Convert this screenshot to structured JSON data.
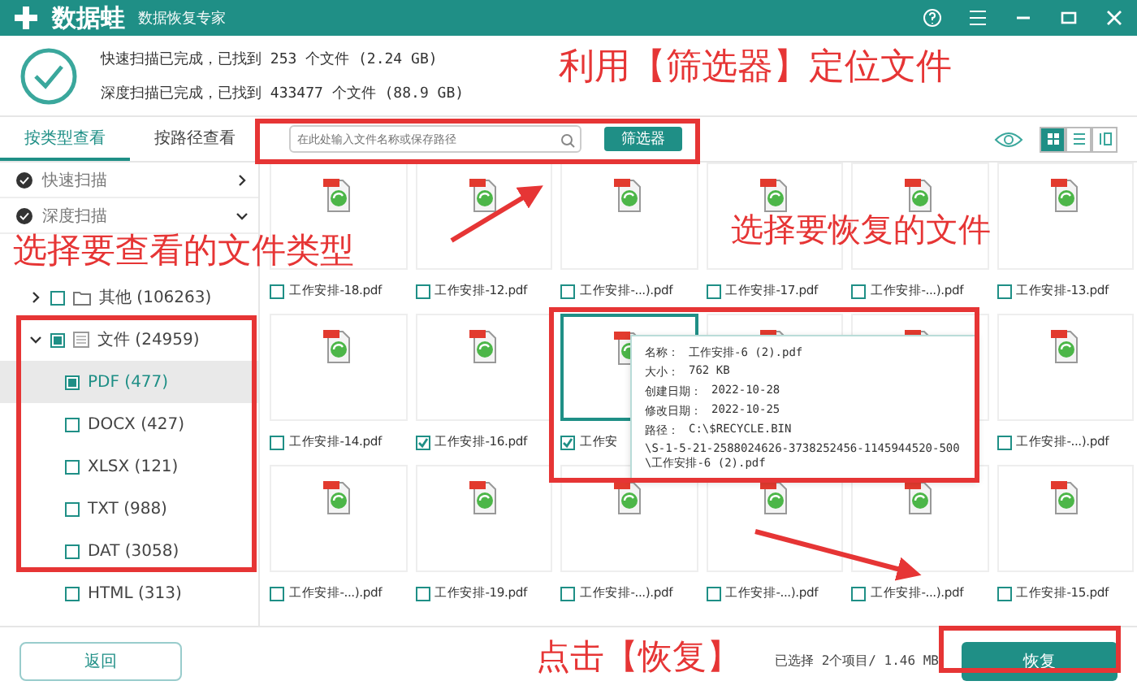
{
  "window": {
    "brand": "数据蛙",
    "subtitle": "数据恢复专家"
  },
  "summary": [
    "快速扫描已完成，已找到 253 个文件 (2.24 GB)",
    "深度扫描已完成，已找到 433477 个文件 (88.9 GB)"
  ],
  "view_tabs": [
    {
      "label": "按类型查看",
      "selected": true
    },
    {
      "label": "按路径查看",
      "selected": false
    }
  ],
  "search": {
    "placeholder": "在此处输入文件名称或保存路径"
  },
  "filter_button": "筛选器",
  "view_modes": [
    {
      "kind": "grid",
      "selected": true
    },
    {
      "kind": "list",
      "selected": false
    },
    {
      "kind": "detail",
      "selected": false
    }
  ],
  "scans": [
    {
      "label": "快速扫描",
      "expanded": false
    },
    {
      "label": "深度扫描",
      "expanded": true
    }
  ],
  "tree": [
    {
      "label": "其他 (106263)",
      "expanded": false,
      "checked": false,
      "kind": "folder"
    },
    {
      "label": "文件 (24959)",
      "expanded": true,
      "checked": true,
      "kind": "document",
      "children": [
        {
          "label": "PDF (477)",
          "checked": true,
          "selected": true
        },
        {
          "label": "DOCX (427)",
          "checked": false,
          "selected": false
        },
        {
          "label": "XLSX (121)",
          "checked": false,
          "selected": false
        },
        {
          "label": "TXT (988)",
          "checked": false,
          "selected": false
        },
        {
          "label": "DAT (3058)",
          "checked": false,
          "selected": false
        },
        {
          "label": "HTML (313)",
          "checked": false,
          "selected": false
        }
      ]
    }
  ],
  "files": [
    {
      "label": "工作安排-18.pdf",
      "checked": false,
      "selected": false
    },
    {
      "label": "工作安排-12.pdf",
      "checked": false,
      "selected": false
    },
    {
      "label": "工作安排-...).pdf",
      "checked": false,
      "selected": false
    },
    {
      "label": "工作安排-17.pdf",
      "checked": false,
      "selected": false
    },
    {
      "label": "工作安排-...).pdf",
      "checked": false,
      "selected": false
    },
    {
      "label": "工作安排-13.pdf",
      "checked": false,
      "selected": false
    },
    {
      "label": "工作安排-14.pdf",
      "checked": false,
      "selected": false
    },
    {
      "label": "工作安排-16.pdf",
      "checked": true,
      "selected": false
    },
    {
      "label": "工作安",
      "checked": true,
      "selected": true
    },
    {
      "selected": false
    },
    {
      "selected": false
    },
    {
      "label": "工作安排-...).pdf",
      "checked": false,
      "selected": false
    },
    {
      "label": "工作安排-...).pdf",
      "checked": false,
      "selected": false
    },
    {
      "label": "工作安排-19.pdf",
      "checked": false,
      "selected": false
    },
    {
      "label": "工作安排-...).pdf",
      "checked": false,
      "selected": false
    },
    {
      "label": "工作安排-...).pdf",
      "checked": false,
      "selected": false
    },
    {
      "label": "工作安排-...).pdf",
      "checked": false,
      "selected": false
    },
    {
      "label": "工作安排-15.pdf",
      "checked": false,
      "selected": false
    }
  ],
  "tooltip": {
    "rows": [
      {
        "key": "名称：",
        "value": "工作安排-6 (2).pdf"
      },
      {
        "key": "大小：",
        "value": "762 KB"
      },
      {
        "key": "创建日期：",
        "value": "2022-10-28"
      },
      {
        "key": "修改日期：",
        "value": "2022-10-25"
      },
      {
        "key": "路径：",
        "value": "C:\\$RECYCLE.BIN"
      }
    ],
    "path_rest": "\\S-1-5-21-2588024626-3738252456-1145944520-500\\工作安排-6 (2).pdf"
  },
  "footer": {
    "back": "返回",
    "status": "已选择 2个项目/ 1.46 MB",
    "recover": "恢复"
  },
  "annotations": [
    "利用【筛选器】定位文件",
    "选择要查看的文件类型",
    "选择要恢复的文件",
    "点击【恢复】"
  ]
}
